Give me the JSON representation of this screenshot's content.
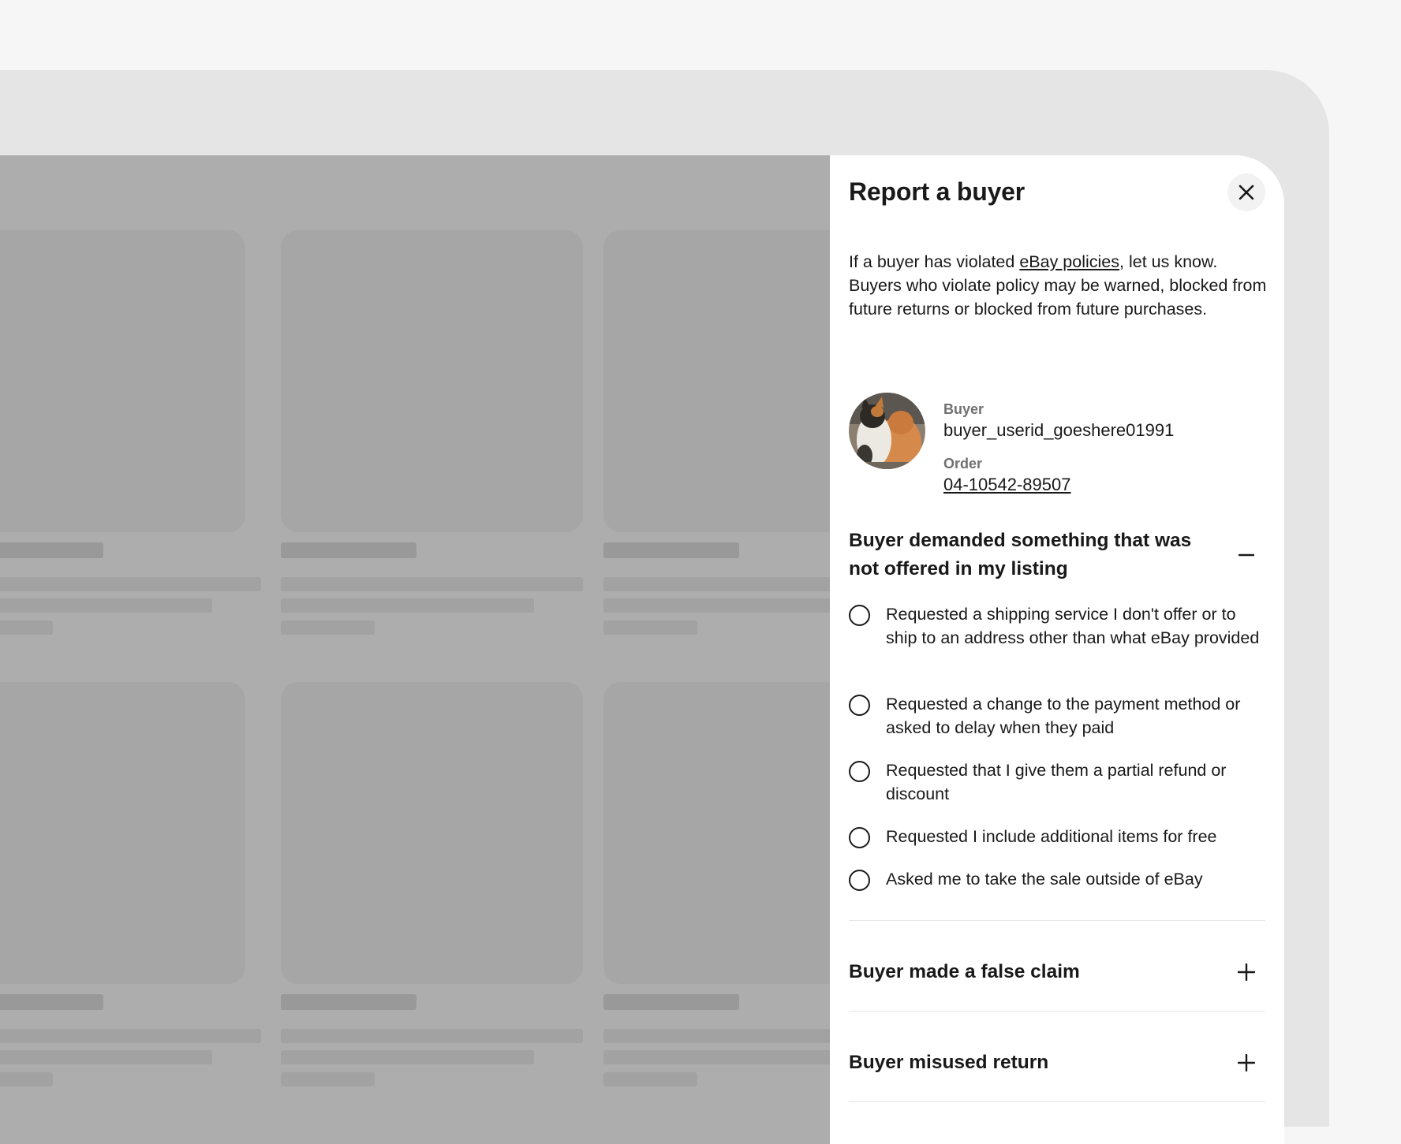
{
  "panel": {
    "title": "Report a buyer",
    "intro_before_link": "If a buyer has violated ",
    "intro_link": "eBay policies",
    "intro_after_link": ", let us know. Buyers who violate policy may be warned, blocked from future returns or blocked from future purchases.",
    "close_icon": "close-icon"
  },
  "buyer": {
    "buyer_label": "Buyer",
    "buyer_id": "buyer_userid_goeshere01991",
    "order_label": "Order",
    "order_number": "04-10542-89507"
  },
  "sections": [
    {
      "title": "Buyer demanded something that was not offered in my listing",
      "expanded": true,
      "toggle_icon": "minus-icon",
      "options": [
        "Requested a shipping service I don't offer or to ship to an address other than what eBay provided",
        "Requested a change to the payment method or asked to delay when they paid",
        "Requested that I give them a partial refund or discount",
        "Requested I include additional items for free",
        "Asked me to take the sale outside of eBay"
      ]
    },
    {
      "title": "Buyer made a false claim",
      "expanded": false,
      "toggle_icon": "plus-icon"
    },
    {
      "title": "Buyer misused return",
      "expanded": false,
      "toggle_icon": "plus-icon"
    }
  ]
}
